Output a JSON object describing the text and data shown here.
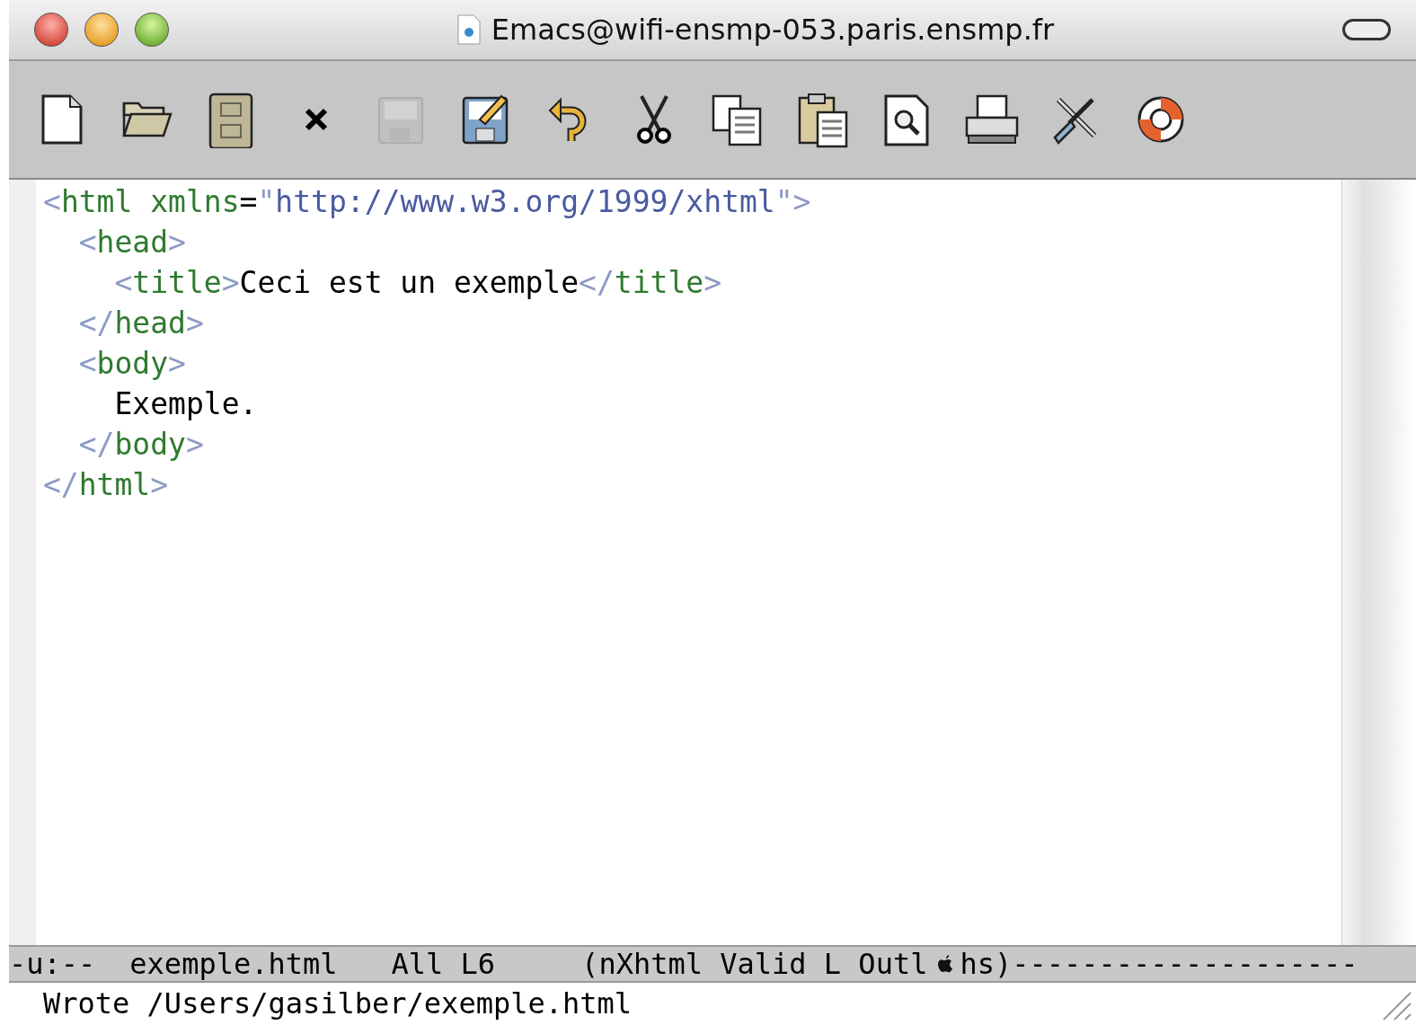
{
  "window": {
    "title": "Emacs@wifi-ensmp-053.paris.ensmp.fr"
  },
  "toolbar": [
    {
      "kind": "new",
      "disabled": false
    },
    {
      "kind": "open",
      "disabled": false
    },
    {
      "kind": "cabinet",
      "disabled": false
    },
    {
      "kind": "close",
      "disabled": false
    },
    {
      "kind": "save",
      "disabled": true
    },
    {
      "kind": "saveas",
      "disabled": false
    },
    {
      "kind": "undo",
      "disabled": false
    },
    {
      "kind": "cut",
      "disabled": false
    },
    {
      "kind": "copy",
      "disabled": false
    },
    {
      "kind": "paste",
      "disabled": false
    },
    {
      "kind": "search",
      "disabled": false
    },
    {
      "kind": "print",
      "disabled": false
    },
    {
      "kind": "tools",
      "disabled": false
    },
    {
      "kind": "help",
      "disabled": false
    }
  ],
  "editor": {
    "lines": [
      [
        {
          "kind": "punct",
          "text": "<"
        },
        {
          "kind": "tag",
          "text": "html"
        },
        {
          "kind": "attr",
          "text": " xmlns"
        },
        {
          "kind": "text",
          "text": "="
        },
        {
          "kind": "punct",
          "text": "\""
        },
        {
          "kind": "string",
          "text": "http://www.w3.org/1999/xhtml"
        },
        {
          "kind": "punct",
          "text": "\">"
        }
      ],
      [
        {
          "kind": "punct",
          "text": "  <"
        },
        {
          "kind": "tag",
          "text": "head"
        },
        {
          "kind": "punct",
          "text": ">"
        }
      ],
      [
        {
          "kind": "punct",
          "text": "    <"
        },
        {
          "kind": "tag",
          "text": "title"
        },
        {
          "kind": "punct",
          "text": ">"
        },
        {
          "kind": "text",
          "text": "Ceci est un exemple"
        },
        {
          "kind": "punct",
          "text": "</"
        },
        {
          "kind": "tag",
          "text": "title"
        },
        {
          "kind": "punct",
          "text": ">"
        }
      ],
      [
        {
          "kind": "punct",
          "text": "  </"
        },
        {
          "kind": "tag",
          "text": "head"
        },
        {
          "kind": "punct",
          "text": ">"
        }
      ],
      [
        {
          "kind": "punct",
          "text": "  <"
        },
        {
          "kind": "tag",
          "text": "body"
        },
        {
          "kind": "punct",
          "text": ">"
        }
      ],
      [
        {
          "kind": "text",
          "text": "    Exemple."
        }
      ],
      [
        {
          "kind": "punct",
          "text": "  </"
        },
        {
          "kind": "tag",
          "text": "body"
        },
        {
          "kind": "punct",
          "text": ">"
        }
      ],
      [
        {
          "kind": "punct",
          "text": "</"
        },
        {
          "kind": "tag",
          "text": "html"
        },
        {
          "kind": "punct",
          "text": ">"
        }
      ]
    ]
  },
  "mode_line": {
    "status": "-u:--",
    "buffer": "exemple.html",
    "position": "All L6",
    "modes": "(nXhtml Valid L Outl",
    "modes_end": "hs)--------------------"
  },
  "minibuffer": {
    "message": "Wrote /Users/gasilber/exemple.html"
  }
}
